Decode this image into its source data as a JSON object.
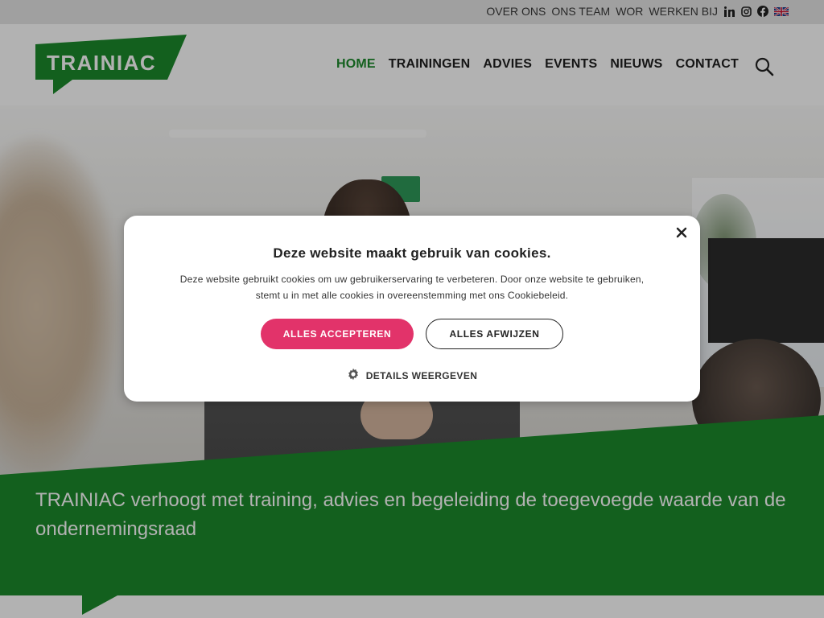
{
  "topbar": {
    "links": [
      "OVER ONS",
      "ONS TEAM",
      "WOR",
      "WERKEN BIJ"
    ],
    "social_icons": [
      "linkedin-icon",
      "instagram-icon",
      "facebook-icon",
      "uk-flag-icon"
    ]
  },
  "header": {
    "logo_text": "TRAINIAC",
    "nav": [
      {
        "label": "HOME",
        "active": true
      },
      {
        "label": "TRAININGEN",
        "active": false
      },
      {
        "label": "ADVIES",
        "active": false
      },
      {
        "label": "EVENTS",
        "active": false
      },
      {
        "label": "NIEUWS",
        "active": false
      },
      {
        "label": "CONTACT",
        "active": false
      }
    ],
    "search_icon": "search-icon"
  },
  "hero": {
    "tagline": "TRAINIAC verhoogt met training, advies en begeleiding de toegevoegde waarde van de ondernemingsraad"
  },
  "cookie_dialog": {
    "title": "Deze website maakt gebruik van cookies.",
    "text": "Deze website gebruikt cookies om uw gebruikerservaring te verbeteren. Door onze website te gebruiken, stemt u in met alle cookies in overeenstemming met ons Cookiebeleid.",
    "accept_label": "ALLES ACCEPTEREN",
    "reject_label": "ALLES AFWIJZEN",
    "details_label": "DETAILS WEERGEVEN",
    "close_icon": "close-icon",
    "details_icon": "gear-icon"
  },
  "colors": {
    "brand_green": "#1c8a2b",
    "accept_pink": "#e2336a",
    "text_dark": "#1f1f1f"
  }
}
